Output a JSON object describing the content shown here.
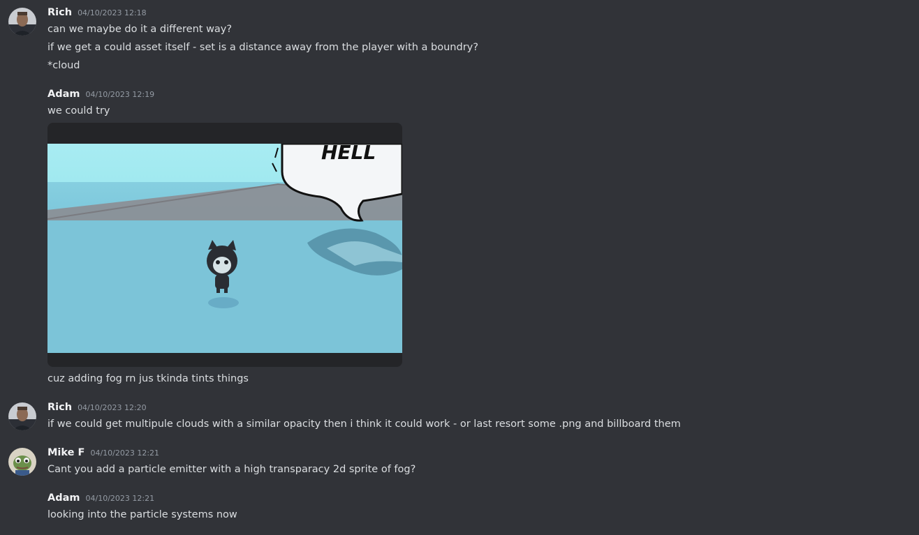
{
  "messages": [
    {
      "author": "Rich",
      "timestamp": "04/10/2023 12:18",
      "lines": [
        "can we maybe do it a different way?",
        "if we get a could asset itself - set is a distance away from the player with a boundry?",
        "*cloud"
      ]
    },
    {
      "author": "Adam",
      "timestamp": "04/10/2023 12:19",
      "lines": [
        "we could try",
        "cuz adding fog rn jus tkinda tints things"
      ],
      "attachment": {
        "type": "image",
        "speech_bubble_text": "HELL",
        "colors": {
          "sky": "#8fe3ea",
          "floor": "#6fbfd6",
          "wall": "#8a8a8e"
        }
      }
    },
    {
      "author": "Rich",
      "timestamp": "04/10/2023 12:20",
      "lines": [
        "if we could get multipule clouds with a similar opacity then i think it could work - or last resort some .png and billboard them"
      ]
    },
    {
      "author": "Mike F",
      "timestamp": "04/10/2023 12:21",
      "lines": [
        "Cant you add a particle emitter with a high transparacy 2d sprite of fog?"
      ]
    },
    {
      "author": "Adam",
      "timestamp": "04/10/2023 12:21",
      "lines": [
        "looking into the particle systems now"
      ]
    }
  ],
  "theme": {
    "background": "#313338",
    "text": "#dbdee1",
    "author": "#f2f3f5",
    "timestamp": "#949ba4"
  }
}
